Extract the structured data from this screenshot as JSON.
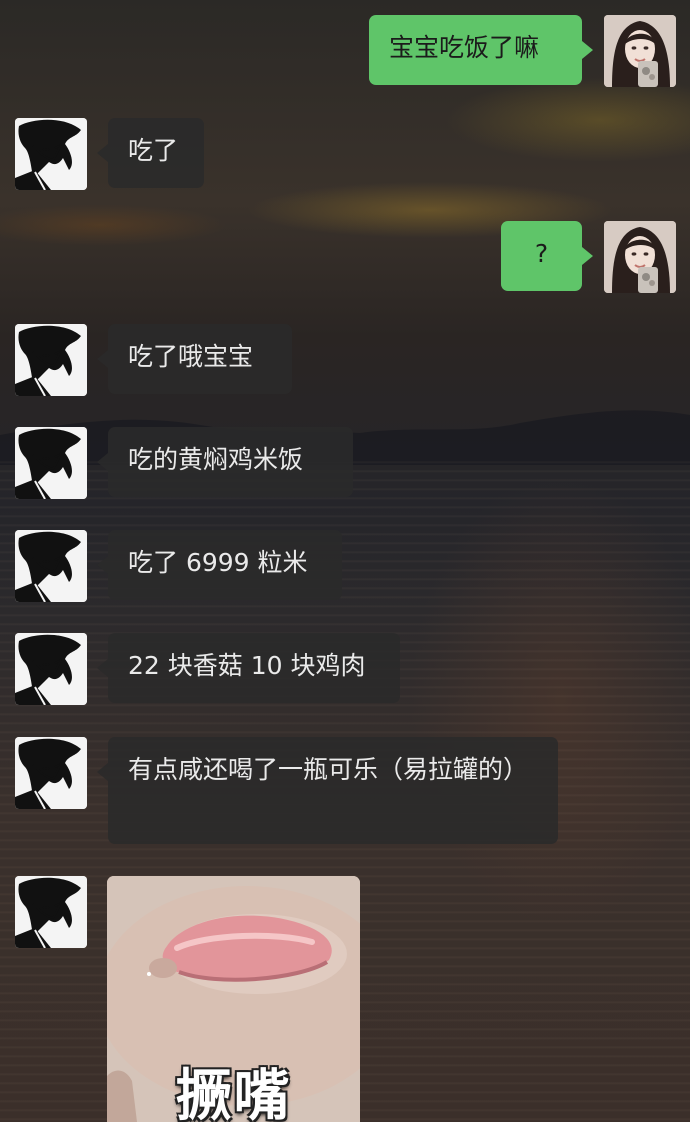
{
  "chat": {
    "messages": [
      {
        "sender": "me",
        "text": "宝宝吃饭了嘛"
      },
      {
        "sender": "other",
        "text": "吃了"
      },
      {
        "sender": "me",
        "text": "?"
      },
      {
        "sender": "other",
        "text": "吃了哦宝宝"
      },
      {
        "sender": "other",
        "text": "吃的黄焖鸡米饭"
      },
      {
        "sender": "other",
        "text": "吃了 6999 粒米"
      },
      {
        "sender": "other",
        "text": "22 块香菇 10 块鸡肉"
      },
      {
        "sender": "other",
        "text": "有点咸还喝了一瓶可乐（易拉罐的）"
      },
      {
        "sender": "other",
        "sticker_text": "撅嘴"
      }
    ]
  },
  "colors": {
    "my_bubble": "#5fc569",
    "their_bubble": "#2a2a2a"
  },
  "icons": {
    "my_avatar": "girl-photo-avatar-icon",
    "their_avatar": "anime-boy-avatar-icon"
  }
}
